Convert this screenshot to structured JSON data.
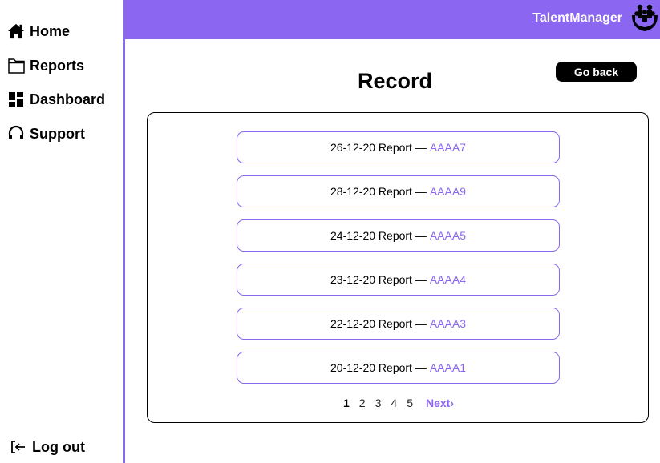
{
  "sidebar": {
    "items": [
      {
        "label": "Home",
        "icon": "home-icon"
      },
      {
        "label": "Reports",
        "icon": "folder-icon"
      },
      {
        "label": "Dashboard",
        "icon": "dashboard-icon"
      },
      {
        "label": "Support",
        "icon": "headset-icon"
      }
    ],
    "logout": {
      "label": "Log out",
      "icon": "logout-icon"
    }
  },
  "header": {
    "brand": "TalentManager",
    "logo_icon": "people-hands-icon",
    "accent_color": "#8b66f0"
  },
  "main": {
    "title": "Record",
    "go_back_label": "Go back",
    "reports": [
      {
        "text": "26-12-20 Report —",
        "code": "AAAA7"
      },
      {
        "text": "28-12-20 Report —",
        "code": "AAAA9"
      },
      {
        "text": "24-12-20 Report —",
        "code": "AAAA5"
      },
      {
        "text": "23-12-20 Report —",
        "code": "AAAA4"
      },
      {
        "text": "22-12-20 Report —",
        "code": "AAAA3"
      },
      {
        "text": "20-12-20 Report —",
        "code": "AAAA1"
      }
    ],
    "pagination": {
      "pages": [
        "1",
        "2",
        "3",
        "4",
        "5"
      ],
      "current": "1",
      "next_label": "Next›"
    }
  }
}
